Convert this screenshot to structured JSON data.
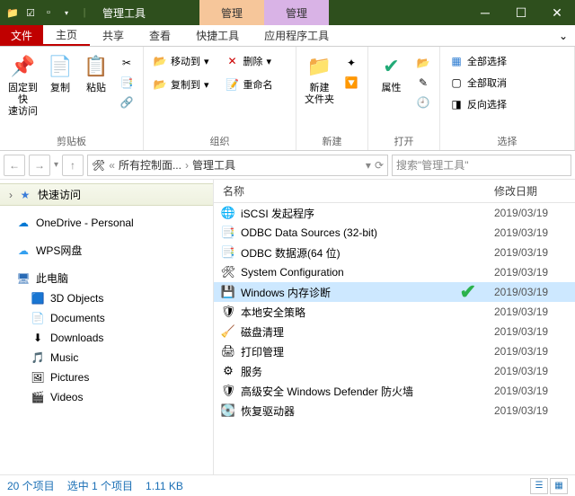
{
  "title": "管理工具",
  "ctx_tabs": [
    "管理",
    "管理"
  ],
  "tabs": {
    "file": "文件",
    "home": "主页",
    "share": "共享",
    "view": "查看",
    "shortcut": "快捷工具",
    "app": "应用程序工具"
  },
  "ribbon": {
    "clipboard": {
      "pin": "固定到快\n速访问",
      "copy": "复制",
      "paste": "粘贴",
      "label": "剪贴板"
    },
    "organize": {
      "moveto": "移动到",
      "copyto": "复制到",
      "delete": "删除",
      "rename": "重命名",
      "label": "组织"
    },
    "new": {
      "newfolder": "新建\n文件夹",
      "label": "新建"
    },
    "open": {
      "properties": "属性",
      "label": "打开"
    },
    "select": {
      "selectall": "全部选择",
      "selectnone": "全部取消",
      "invert": "反向选择",
      "label": "选择"
    }
  },
  "nav": {
    "back": "←",
    "fwd": "→",
    "up": "↑"
  },
  "breadcrumb": {
    "seg1": "所有控制面...",
    "seg2": "管理工具"
  },
  "search_placeholder": "搜索\"管理工具\"",
  "columns": {
    "name": "名称",
    "date": "修改日期"
  },
  "sidebar": {
    "quick": "快速访问",
    "onedrive": "OneDrive - Personal",
    "wps": "WPS网盘",
    "thispc": "此电脑",
    "items": [
      "3D Objects",
      "Documents",
      "Downloads",
      "Music",
      "Pictures",
      "Videos"
    ]
  },
  "files": [
    {
      "name": "iSCSI 发起程序",
      "date": "2019/03/19",
      "ico": "🌐"
    },
    {
      "name": "ODBC Data Sources (32-bit)",
      "date": "2019/03/19",
      "ico": "📑"
    },
    {
      "name": "ODBC 数据源(64 位)",
      "date": "2019/03/19",
      "ico": "📑"
    },
    {
      "name": "System Configuration",
      "date": "2019/03/19",
      "ico": "🛠"
    },
    {
      "name": "Windows 内存诊断",
      "date": "2019/03/19",
      "ico": "💾",
      "selected": true,
      "check": true
    },
    {
      "name": "本地安全策略",
      "date": "2019/03/19",
      "ico": "🛡"
    },
    {
      "name": "磁盘清理",
      "date": "2019/03/19",
      "ico": "🧹"
    },
    {
      "name": "打印管理",
      "date": "2019/03/19",
      "ico": "🖨"
    },
    {
      "name": "服务",
      "date": "2019/03/19",
      "ico": "⚙"
    },
    {
      "name": "高级安全 Windows Defender 防火墙",
      "date": "2019/03/19",
      "ico": "🛡"
    },
    {
      "name": "恢复驱动器",
      "date": "2019/03/19",
      "ico": "💽"
    }
  ],
  "status": {
    "count": "20 个项目",
    "selected": "选中 1 个项目",
    "size": "1.11 KB"
  }
}
